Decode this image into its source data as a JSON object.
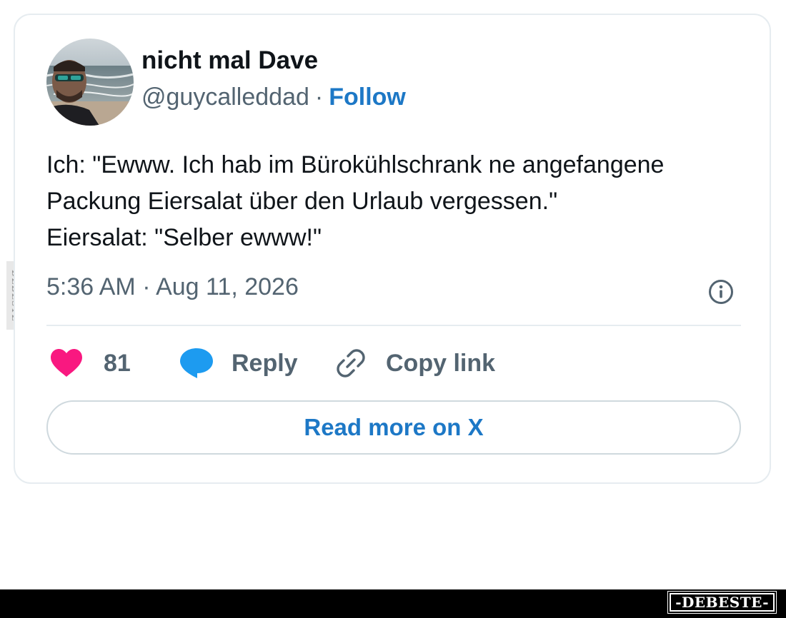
{
  "watermark": {
    "side_text": "DEBESTE",
    "brand_text": "-DEBESTE-"
  },
  "tweet": {
    "author_name": "nicht mal Dave",
    "handle": "@guycalleddad",
    "separator": "·",
    "follow_label": "Follow",
    "text_lines": [
      "Ich: \"Ewww. Ich hab im Bürokühlschrank ne angefangene",
      "Packung Eiersalat über den Urlaub vergessen.\"",
      "Eiersalat: \"Selber ewww!\""
    ],
    "timestamp": "5:36 AM · Aug 11, 2026",
    "like_count": "81",
    "reply_label": "Reply",
    "copy_link_label": "Copy link",
    "read_more_label": "Read more on X"
  },
  "colors": {
    "accent_blue": "#1d78c6",
    "like_pink": "#f91880",
    "reply_blue": "#1d9bf0",
    "muted_text": "#536471",
    "border": "#e6ecf0"
  },
  "icons": {
    "info": "info-circle-icon",
    "like": "heart-icon",
    "reply": "speech-bubble-icon",
    "copy_link": "link-icon"
  }
}
